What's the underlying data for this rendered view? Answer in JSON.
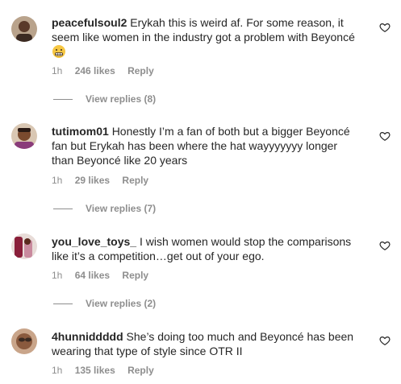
{
  "comments": [
    {
      "username": "peacefulsoul2",
      "text": "Erykah this is weird af. For some reason, it seem like women in the industry got a problem with Beyoncé",
      "emoji": "grimacing-face",
      "time": "1h",
      "likes": "246 likes",
      "reply": "Reply",
      "view_replies": "View replies (8)"
    },
    {
      "username": "tutimom01",
      "text": "Honestly I’m a fan of both but a bigger Beyoncé fan but Erykah has been where the hat wayyyyyyy longer than Beyoncé like 20 years",
      "time": "1h",
      "likes": "29 likes",
      "reply": "Reply",
      "view_replies": "View replies (7)"
    },
    {
      "username": "you_love_toys_",
      "text": "I wish women would stop the comparisons like it’s a competition…get out of your ego.",
      "time": "1h",
      "likes": "64 likes",
      "reply": "Reply",
      "view_replies": "View replies (2)"
    },
    {
      "username": "4hunniddddd",
      "text": "She’s doing too much and Beyoncé has been wearing that type of style since OTR II",
      "time": "1h",
      "likes": "135 likes",
      "reply": "Reply"
    }
  ]
}
